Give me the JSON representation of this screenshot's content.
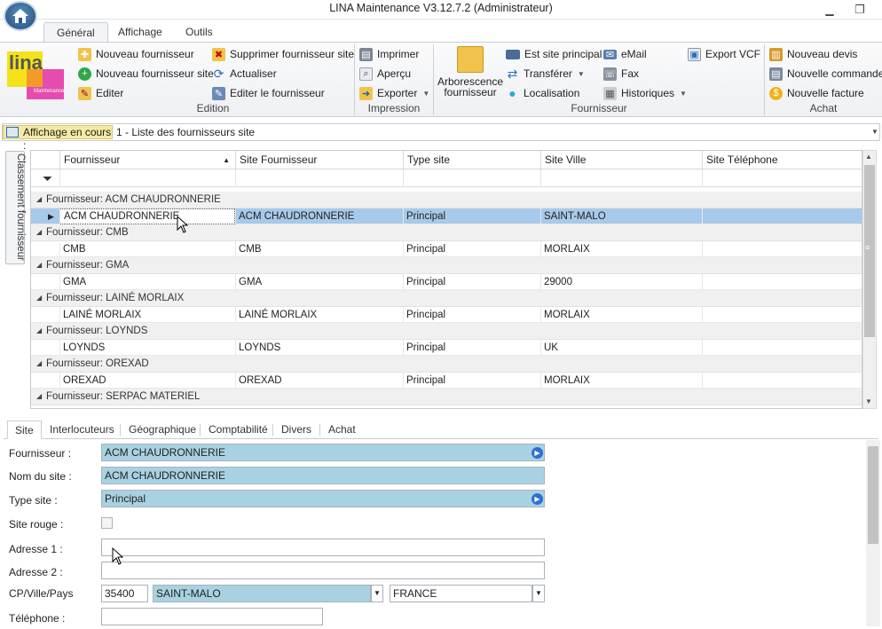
{
  "window": {
    "title": "LINA Maintenance  V3.12.7.2  (Administrateur)"
  },
  "ribbon_tabs": [
    "Général",
    "Affichage",
    "Outils"
  ],
  "logo": {
    "text": "lina",
    "sub": "Maintenance"
  },
  "edition": {
    "nouveau_fournisseur": "Nouveau fournisseur",
    "nouveau_fournisseur_site": "Nouveau fournisseur site",
    "editer": "Editer",
    "supprimer_fournisseur_site": "Supprimer fournisseur site",
    "actualiser": "Actualiser",
    "editer_le_fournisseur": "Editer le fournisseur",
    "group_label": "Edition"
  },
  "impression": {
    "imprimer": "Imprimer",
    "apercu": "Aperçu",
    "exporter": "Exporter",
    "group_label": "Impression"
  },
  "fournisseur_group": {
    "arborescence": "Arborescence fournisseur",
    "est_site_principal": "Est site principal",
    "transferer": "Transférer",
    "localisation": "Localisation",
    "email": "eMail",
    "fax": "Fax",
    "historiques": "Historiques",
    "export_vcf": "Export VCF",
    "group_label": "Fournisseur"
  },
  "achat": {
    "nouveau_devis": "Nouveau devis",
    "nouvelle_commande": "Nouvelle commande",
    "nouvelle_facture": "Nouvelle facture",
    "group_label": "Achat"
  },
  "affichage": {
    "label": "Affichage en cours :",
    "value": "1 - Liste des fournisseurs site"
  },
  "side_tab": "Classement fournisseur",
  "grid": {
    "columns": [
      "Fournisseur",
      "Site Fournisseur",
      "Type site",
      "Site Ville",
      "Site Téléphone"
    ],
    "groups": [
      {
        "label": "Fournisseur: ACM CHAUDRONNERIE",
        "row": [
          "ACM CHAUDRONNERIE",
          "ACM CHAUDRONNERIE",
          "Principal",
          "SAINT-MALO",
          ""
        ]
      },
      {
        "label": "Fournisseur: CMB",
        "row": [
          "CMB",
          "CMB",
          "Principal",
          "MORLAIX",
          ""
        ]
      },
      {
        "label": "Fournisseur: GMA",
        "row": [
          "GMA",
          "GMA",
          "Principal",
          "29000",
          ""
        ]
      },
      {
        "label": "Fournisseur: LAINÉ MORLAIX",
        "row": [
          "LAINÉ MORLAIX",
          "LAINÉ MORLAIX",
          "Principal",
          "MORLAIX",
          ""
        ]
      },
      {
        "label": "Fournisseur: LOYNDS",
        "row": [
          "LOYNDS",
          "LOYNDS",
          "Principal",
          "UK",
          ""
        ]
      },
      {
        "label": "Fournisseur: OREXAD",
        "row": [
          "OREXAD",
          "OREXAD",
          "Principal",
          "MORLAIX",
          ""
        ]
      },
      {
        "label": "Fournisseur: SERPAC MATERIEL",
        "row": null
      }
    ]
  },
  "detail_tabs": [
    "Site",
    "Interlocuteurs",
    "Géographique",
    "Comptabilité",
    "Divers",
    "Achat"
  ],
  "form": {
    "fournisseur_label": "Fournisseur :",
    "fournisseur_value": "ACM CHAUDRONNERIE",
    "nom_site_label": "Nom du site :",
    "nom_site_value": "ACM CHAUDRONNERIE",
    "type_site_label": "Type site :",
    "type_site_value": "Principal",
    "site_rouge_label": "Site rouge :",
    "adresse1_label": "Adresse 1 :",
    "adresse1_value": "",
    "adresse2_label": "Adresse 2 :",
    "adresse2_value": "",
    "cp_label": "CP/Ville/Pays",
    "cp_value": "35400",
    "ville_value": "SAINT-MALO",
    "pays_value": "FRANCE",
    "telephone_label": "Téléphone :",
    "telephone_value": ""
  }
}
